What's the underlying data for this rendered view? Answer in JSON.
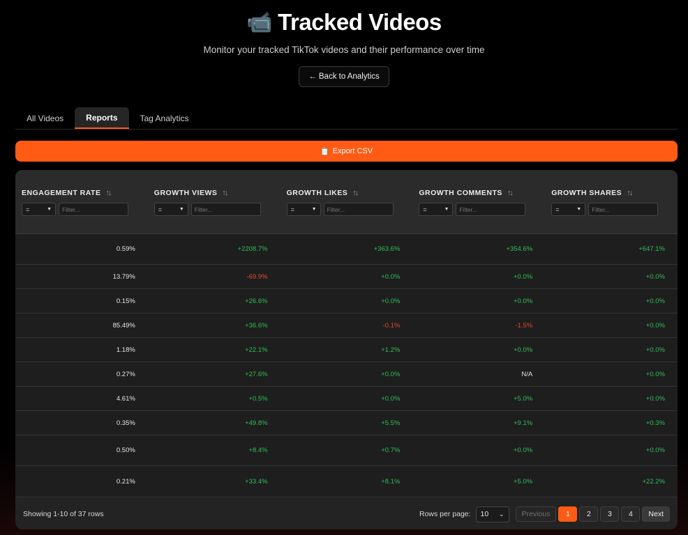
{
  "header": {
    "icon": "movie-camera-icon",
    "title": "Tracked Videos",
    "subtitle": "Monitor your tracked TikTok videos and their performance over time",
    "back_label": "← Back to Analytics"
  },
  "tabs": [
    {
      "label": "All Videos",
      "active": false
    },
    {
      "label": "Reports",
      "active": true
    },
    {
      "label": "Tag Analytics",
      "active": false
    }
  ],
  "export": {
    "icon": "clipboard-icon",
    "label": "Export CSV"
  },
  "table": {
    "columns": [
      {
        "label": "ENGAGEMENT RATE",
        "operator": "=",
        "filter_placeholder": "Filter..."
      },
      {
        "label": "GROWTH VIEWS",
        "operator": "=",
        "filter_placeholder": "Filter..."
      },
      {
        "label": "GROWTH LIKES",
        "operator": "=",
        "filter_placeholder": "Filter..."
      },
      {
        "label": "GROWTH COMMENTS",
        "operator": "=",
        "filter_placeholder": "Filter..."
      },
      {
        "label": "GROWTH SHARES",
        "operator": "=",
        "filter_placeholder": "Filter..."
      }
    ],
    "rows": [
      [
        "0.59%",
        "+2208.7%",
        "+363.6%",
        "+354.6%",
        "+647.1%"
      ],
      [
        "13.79%",
        "-69.9%",
        "+0.0%",
        "+0.0%",
        "+0.0%"
      ],
      [
        "0.15%",
        "+26.6%",
        "+0.0%",
        "+0.0%",
        "+0.0%"
      ],
      [
        "85.49%",
        "+36.6%",
        "-0.1%",
        "-1.5%",
        "+0.0%"
      ],
      [
        "1.18%",
        "+22.1%",
        "+1.2%",
        "+0.0%",
        "+0.0%"
      ],
      [
        "0.27%",
        "+27.6%",
        "+0.0%",
        "N/A",
        "+0.0%"
      ],
      [
        "4.61%",
        "+0.5%",
        "+0.0%",
        "+5.0%",
        "+0.0%"
      ],
      [
        "0.35%",
        "+49.8%",
        "+5.5%",
        "+9.1%",
        "+0.3%"
      ],
      [
        "0.50%",
        "+8.4%",
        "+0.7%",
        "+0.0%",
        "+0.0%"
      ],
      [
        "0.21%",
        "+33.4%",
        "+8.1%",
        "+5.0%",
        "+22.2%"
      ]
    ]
  },
  "footer": {
    "showing": "Showing 1-10 of 37 rows",
    "rows_per_page_label": "Rows per page:",
    "rows_per_page": "10",
    "previous": "Previous",
    "pages": [
      "1",
      "2",
      "3",
      "4"
    ],
    "current_page": "1",
    "next": "Next"
  },
  "colors": {
    "accent": "#ff5b14",
    "positive": "#2fbf57",
    "negative": "#e2492f",
    "background": "#000000",
    "card": "#232323"
  }
}
